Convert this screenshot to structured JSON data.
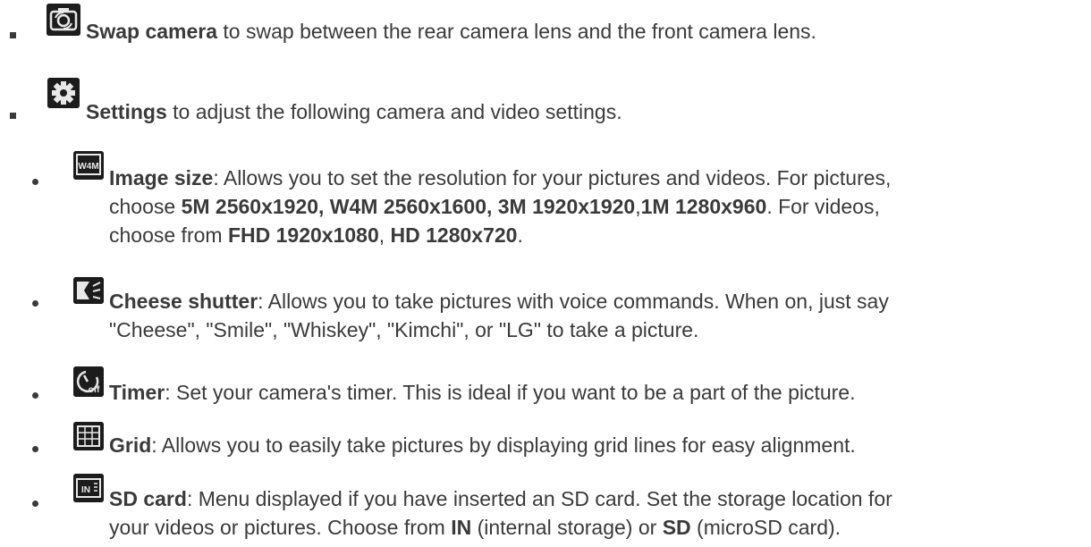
{
  "items": [
    {
      "icon": "swap-camera-icon",
      "term": "Swap camera",
      "desc": " to swap between the rear camera lens and the front camera lens."
    },
    {
      "icon": "gear-icon",
      "term": "Settings",
      "desc": " to adjust the following camera and video settings."
    }
  ],
  "settings": {
    "image_size": {
      "icon": "image-size-icon",
      "term": "Image size",
      "line1_rest": ": Allows you to set the resolution for your pictures and videos. For pictures,",
      "line2_pre": "choose ",
      "line2_opts": "5M 2560x1920, W4M 2560x1600, 3M 1920x1920",
      "line2_comma": ",",
      "line2_opt2": "1M 1280x960",
      "line2_tail": ". For videos,",
      "line3_pre": "choose from ",
      "line3_opt1": "FHD 1920x1080",
      "line3_sep": ", ",
      "line3_opt2": "HD 1280x720",
      "line3_end": "."
    },
    "cheese_shutter": {
      "icon": "cheese-shutter-icon",
      "term": "Cheese shutter",
      "line1_rest": ": Allows you to take pictures with voice commands. When on, just say",
      "line2": "\"Cheese\", \"Smile\", \"Whiskey\", \"Kimchi\", or \"LG\" to take a picture."
    },
    "timer": {
      "icon": "timer-icon",
      "term": "Timer",
      "line1_rest": ": Set your camera's timer. This is ideal if you want to be a part of the picture."
    },
    "grid": {
      "icon": "grid-icon",
      "term": "Grid",
      "line1_rest": ": Allows you to easily take pictures by displaying grid lines for easy alignment."
    },
    "sd_card": {
      "icon": "sd-card-icon",
      "term": "SD card",
      "line1_rest": ": Menu displayed if you have inserted an SD card. Set the storage location for",
      "line2_pre": "your videos or pictures. Choose from ",
      "line2_opt1": "IN",
      "line2_mid": " (internal storage) or ",
      "line2_opt2": "SD",
      "line2_end": " (microSD card)."
    }
  },
  "icon_labels": {
    "image_size_badge": "W4M",
    "timer_badge": "off",
    "sd_badge": "IN"
  }
}
